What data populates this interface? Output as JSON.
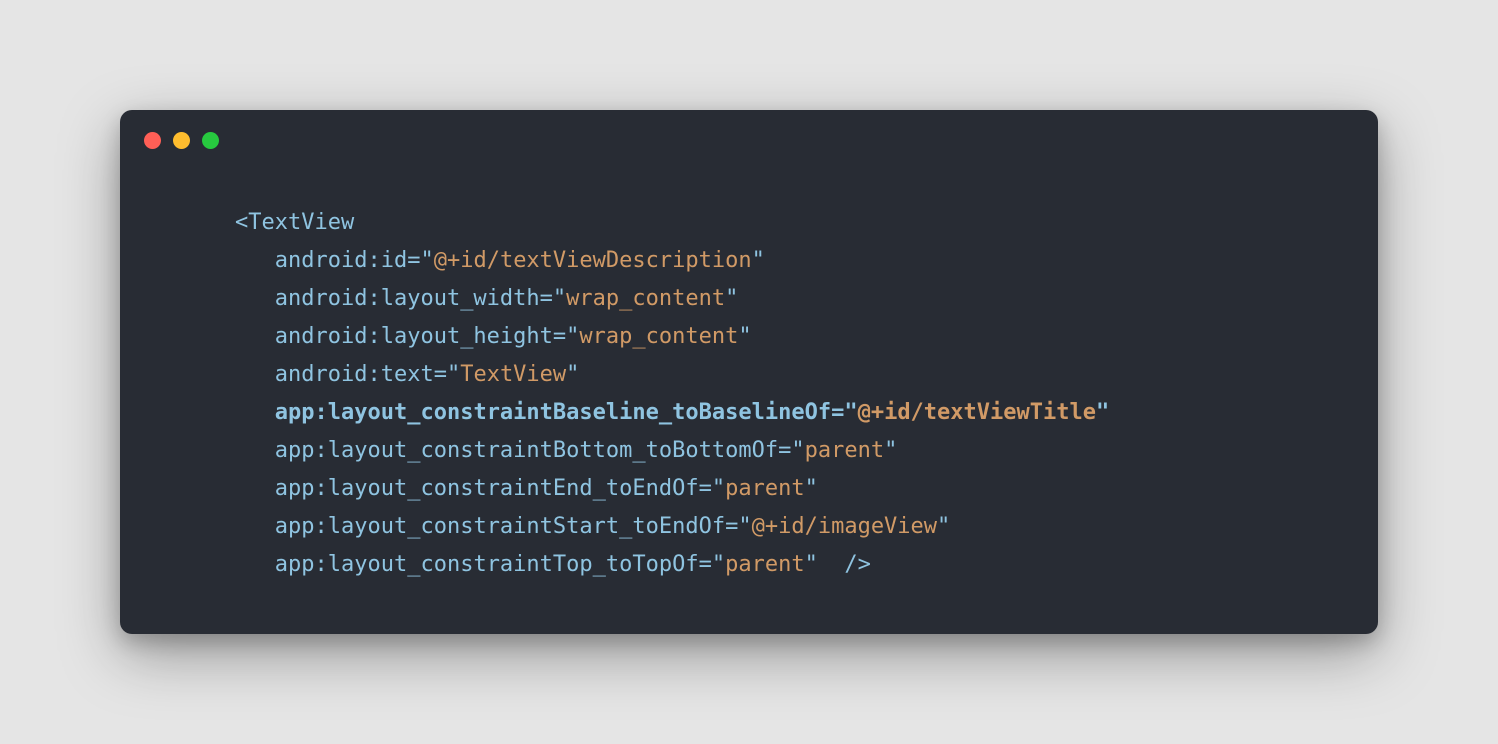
{
  "code": {
    "tagOpen": "<TextView",
    "tagClose": "/>",
    "lines": [
      {
        "ns": "android",
        "attr": "id",
        "val": "@+id/textViewDescription",
        "bold": false
      },
      {
        "ns": "android",
        "attr": "layout_width",
        "val": "wrap_content",
        "bold": false
      },
      {
        "ns": "android",
        "attr": "layout_height",
        "val": "wrap_content",
        "bold": false
      },
      {
        "ns": "android",
        "attr": "text",
        "val": "TextView",
        "bold": false
      },
      {
        "ns": "app",
        "attr": "layout_constraintBaseline_toBaselineOf",
        "val": "@+id/textViewTitle",
        "bold": true
      },
      {
        "ns": "app",
        "attr": "layout_constraintBottom_toBottomOf",
        "val": "parent",
        "bold": false
      },
      {
        "ns": "app",
        "attr": "layout_constraintEnd_toEndOf",
        "val": "parent",
        "bold": false
      },
      {
        "ns": "app",
        "attr": "layout_constraintStart_toEndOf",
        "val": "@+id/imageView",
        "bold": false
      },
      {
        "ns": "app",
        "attr": "layout_constraintTop_toTopOf",
        "val": "parent",
        "bold": false
      }
    ]
  }
}
